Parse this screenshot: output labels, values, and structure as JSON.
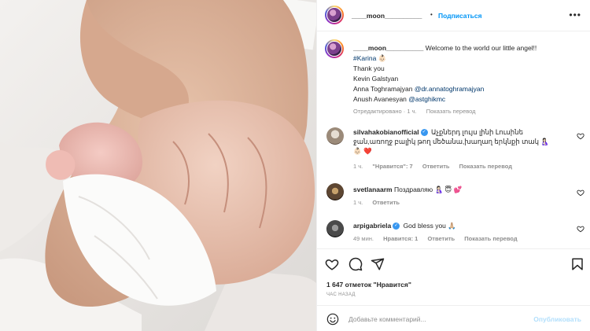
{
  "post": {
    "username": "____moon__________",
    "follow_label": "Подписаться",
    "more_label": "•••"
  },
  "caption": {
    "username": "____moon__________",
    "text": "Welcome to the world our little angel!!",
    "hashtag": "#Karina",
    "hashtag_emoji": "👶🏻",
    "line_thanks": "Thank you",
    "line_1": "Kevin Galstyan",
    "line_2_name": "Anna Toghramajyan",
    "line_2_mention": "@dr.annatoghramajyan",
    "line_3_name": "Anush Avanesyan",
    "line_3_mention": "@astghikmc",
    "edited": "Отредактировано · 1 ч.",
    "translate": "Показать перевод"
  },
  "comments": [
    {
      "username": "silvahakobianofficial",
      "verified": true,
      "text": "Աչքներդ լույս լինի Լուսինե ջան,առողջ բալիկ թող մեծանա,խաղաղ երկնքի տակ 🤱🏻",
      "text2": "👶🏻 ❤️",
      "time": "1 ч.",
      "likes": "\"Нравится\": 7",
      "reply": "Ответить",
      "translate": "Показать перевод"
    },
    {
      "username": "svetlanaarm",
      "verified": false,
      "text": "Поздравляю 🤱🏻 😇 💕",
      "time": "1 ч.",
      "reply": "Ответить"
    },
    {
      "username": "arpigabriela",
      "verified": true,
      "text": "God bless you 🙏🏼",
      "time": "49 мин.",
      "likes": "Нравится: 1",
      "reply": "Ответить",
      "translate": "Показать перевод"
    }
  ],
  "actions": {
    "likes_text": "1 647 отметок \"Нравится\"",
    "time_ago": "ЧАС НАЗАД"
  },
  "composer": {
    "placeholder": "Добавьте комментарий...",
    "publish_label": "Опубликовать"
  },
  "colors": {
    "accent": "#0095f6",
    "link": "#00376b",
    "muted": "#8e8e8e",
    "heart_red": "#ed4956",
    "publish_disabled": "#b2dffc"
  }
}
